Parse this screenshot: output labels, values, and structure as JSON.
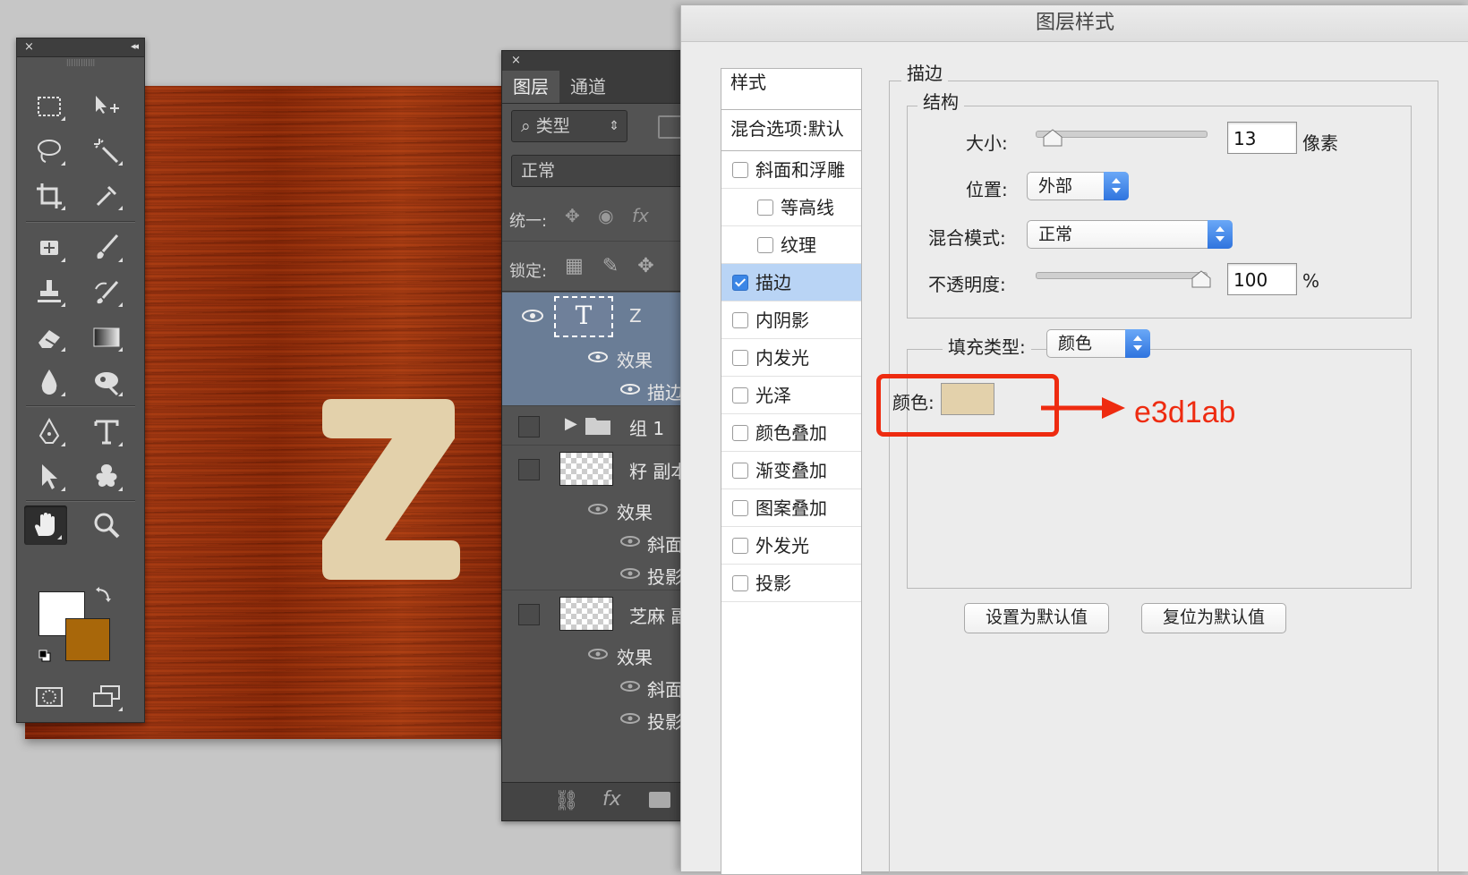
{
  "tools_panel": {
    "close": "×",
    "collapse": "◂◂",
    "tools": [
      "marquee-icon",
      "move-icon",
      "lasso-icon",
      "magic-wand-icon",
      "crop-icon",
      "eyedropper-icon",
      "healing-brush-icon",
      "brush-icon",
      "clone-stamp-icon",
      "history-brush-icon",
      "eraser-icon",
      "gradient-icon",
      "blur-icon",
      "dodge-icon",
      "pen-icon",
      "type-icon",
      "path-selection-icon",
      "custom-shape-icon",
      "hand-icon",
      "zoom-icon"
    ],
    "foreground_color": "#ffffff",
    "background_color": "#a8670a"
  },
  "canvas": {
    "letter": "Z",
    "letter_color": "#e3d1ab",
    "wood_color": "#a13611"
  },
  "layers_panel": {
    "close": "×",
    "tabs": [
      "图层",
      "通道"
    ],
    "filter_label": "类型",
    "blend_mode": "正常",
    "unify_label": "统一:",
    "lock_label": "锁定:",
    "layers": [
      {
        "name": "Z",
        "thumb": "T",
        "effects_label": "效果",
        "effects": [
          "描边"
        ]
      },
      {
        "name": "组 1"
      },
      {
        "name": "籽 副本",
        "effects_label": "效果",
        "effects": [
          "斜面和",
          "投影"
        ]
      },
      {
        "name": "芝麻 副",
        "effects_label": "效果",
        "effects": [
          "斜面和",
          "投影"
        ]
      }
    ]
  },
  "dialog": {
    "title": "图层样式",
    "styles_header": "样式",
    "blend_options": "混合选项:默认",
    "styles": [
      {
        "label": "斜面和浮雕",
        "checked": false,
        "indent": false
      },
      {
        "label": "等高线",
        "checked": false,
        "indent": true
      },
      {
        "label": "纹理",
        "checked": false,
        "indent": true
      },
      {
        "label": "描边",
        "checked": true,
        "indent": false,
        "selected": true
      },
      {
        "label": "内阴影",
        "checked": false,
        "indent": false
      },
      {
        "label": "内发光",
        "checked": false,
        "indent": false
      },
      {
        "label": "光泽",
        "checked": false,
        "indent": false
      },
      {
        "label": "颜色叠加",
        "checked": false,
        "indent": false
      },
      {
        "label": "渐变叠加",
        "checked": false,
        "indent": false
      },
      {
        "label": "图案叠加",
        "checked": false,
        "indent": false
      },
      {
        "label": "外发光",
        "checked": false,
        "indent": false
      },
      {
        "label": "投影",
        "checked": false,
        "indent": false
      }
    ],
    "stroke_group": "描边",
    "structure_group": "结构",
    "size_label": "大小:",
    "size_value": "13",
    "size_unit": "像素",
    "position_label": "位置:",
    "position_value": "外部",
    "blend_mode_label": "混合模式:",
    "blend_mode_value": "正常",
    "opacity_label": "不透明度:",
    "opacity_value": "100",
    "opacity_unit": "%",
    "fill_type_label": "填充类型:",
    "fill_type_value": "颜色",
    "color_label": "颜色:",
    "color_value": "#e3d1ab",
    "set_default": "设置为默认值",
    "reset_default": "复位为默认值"
  },
  "annotation": {
    "text": "e3d1ab",
    "color": "#ee2b10"
  }
}
